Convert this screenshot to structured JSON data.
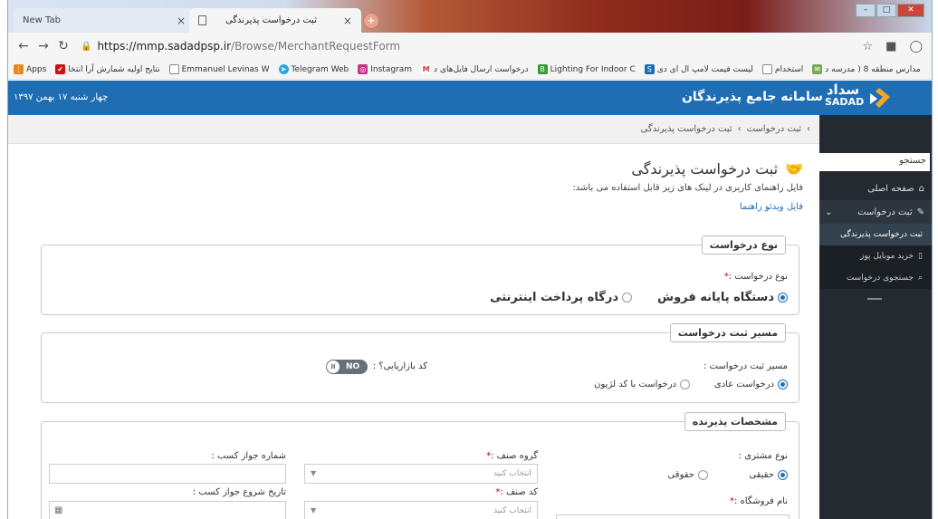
{
  "browser": {
    "tabs": [
      {
        "label": "New Tab"
      },
      {
        "label": "ثبت درخواست پذیرندگی"
      }
    ],
    "url_host": "https://mmp.sadadpsp.ir",
    "url_path": "/Browse/MerchantRequestForm",
    "bookmarks": [
      "Apps",
      "نتایج اولیه شمارش آرا انتخا",
      "Emmanuel Levinas W",
      "Telegram Web",
      "Instagram",
      "درخواست ارسال فایل‌های د",
      "Lighting For Indoor C",
      "لیست قیمت لامپ ال ای دی",
      "استخدام",
      "مدارس منطقه 8 ( مدرسه د"
    ]
  },
  "header": {
    "logo_text": "سداد",
    "logo_sub": "SADAD",
    "title": "سامانه جامع پذیرندگان",
    "date": "چهار شنبه ۱۷ بهمن ۱۳۹۷"
  },
  "sidebar": {
    "search_placeholder": "جستجو",
    "items": [
      {
        "label": "صفحه اصلی"
      },
      {
        "label": "ثبت درخواست"
      }
    ],
    "subitems": [
      {
        "label": "ثبت درخواست پذیرندگی"
      },
      {
        "label": "خرید موبایل پوز"
      },
      {
        "label": "جستجوی درخواست"
      }
    ]
  },
  "breadcrumb": {
    "item1": "ثبت درخواست",
    "sep": "›",
    "item2": "ثبت درخواست پذیرندگی"
  },
  "page": {
    "title": "ثبت درخواست پذیرندگی",
    "subtitle": "فایل راهنمای کاربری در لینک های زیر قابل استفاده می باشد:",
    "video_link": "فایل ویدئو راهنما"
  },
  "request_type": {
    "legend": "نوع درخواست",
    "label": "نوع درخواست :",
    "options": [
      {
        "label": "دستگاه پایانه فروش",
        "selected": true
      },
      {
        "label": "درگاه پرداخت اینترنتی",
        "selected": false
      }
    ]
  },
  "route": {
    "legend": "مسیر ثبت درخواست",
    "label": "مسیر ثبت درخواست :",
    "options": [
      {
        "label": "درخواست عادی",
        "selected": true
      },
      {
        "label": "درخواست با کد لژیون",
        "selected": false
      }
    ],
    "marketing_label": "کد بازاریابی؟ :",
    "toggle_text": "NO",
    "toggle_knob": "II"
  },
  "merchant": {
    "legend": "مشخصات پذیرنده",
    "customer_type_label": "نوع مشتری :",
    "customer_types": [
      {
        "label": "حقیقی",
        "selected": true
      },
      {
        "label": "حقوقی",
        "selected": false
      }
    ],
    "guild_group_label": "گروه صنف :",
    "guild_group_placeholder": "انتخاب کنید",
    "license_no_label": "شماره جواز کسب :",
    "guild_code_label": "کد صنف :",
    "guild_code_placeholder": "انتخاب کنید",
    "license_start_label": "تاریخ شروع جواز کسب :",
    "store_name_label": "نام فروشگاه :"
  },
  "colors": {
    "header_blue": "#1f6db3",
    "sidebar_dark": "#242a30",
    "required_star": "#cc0000"
  }
}
